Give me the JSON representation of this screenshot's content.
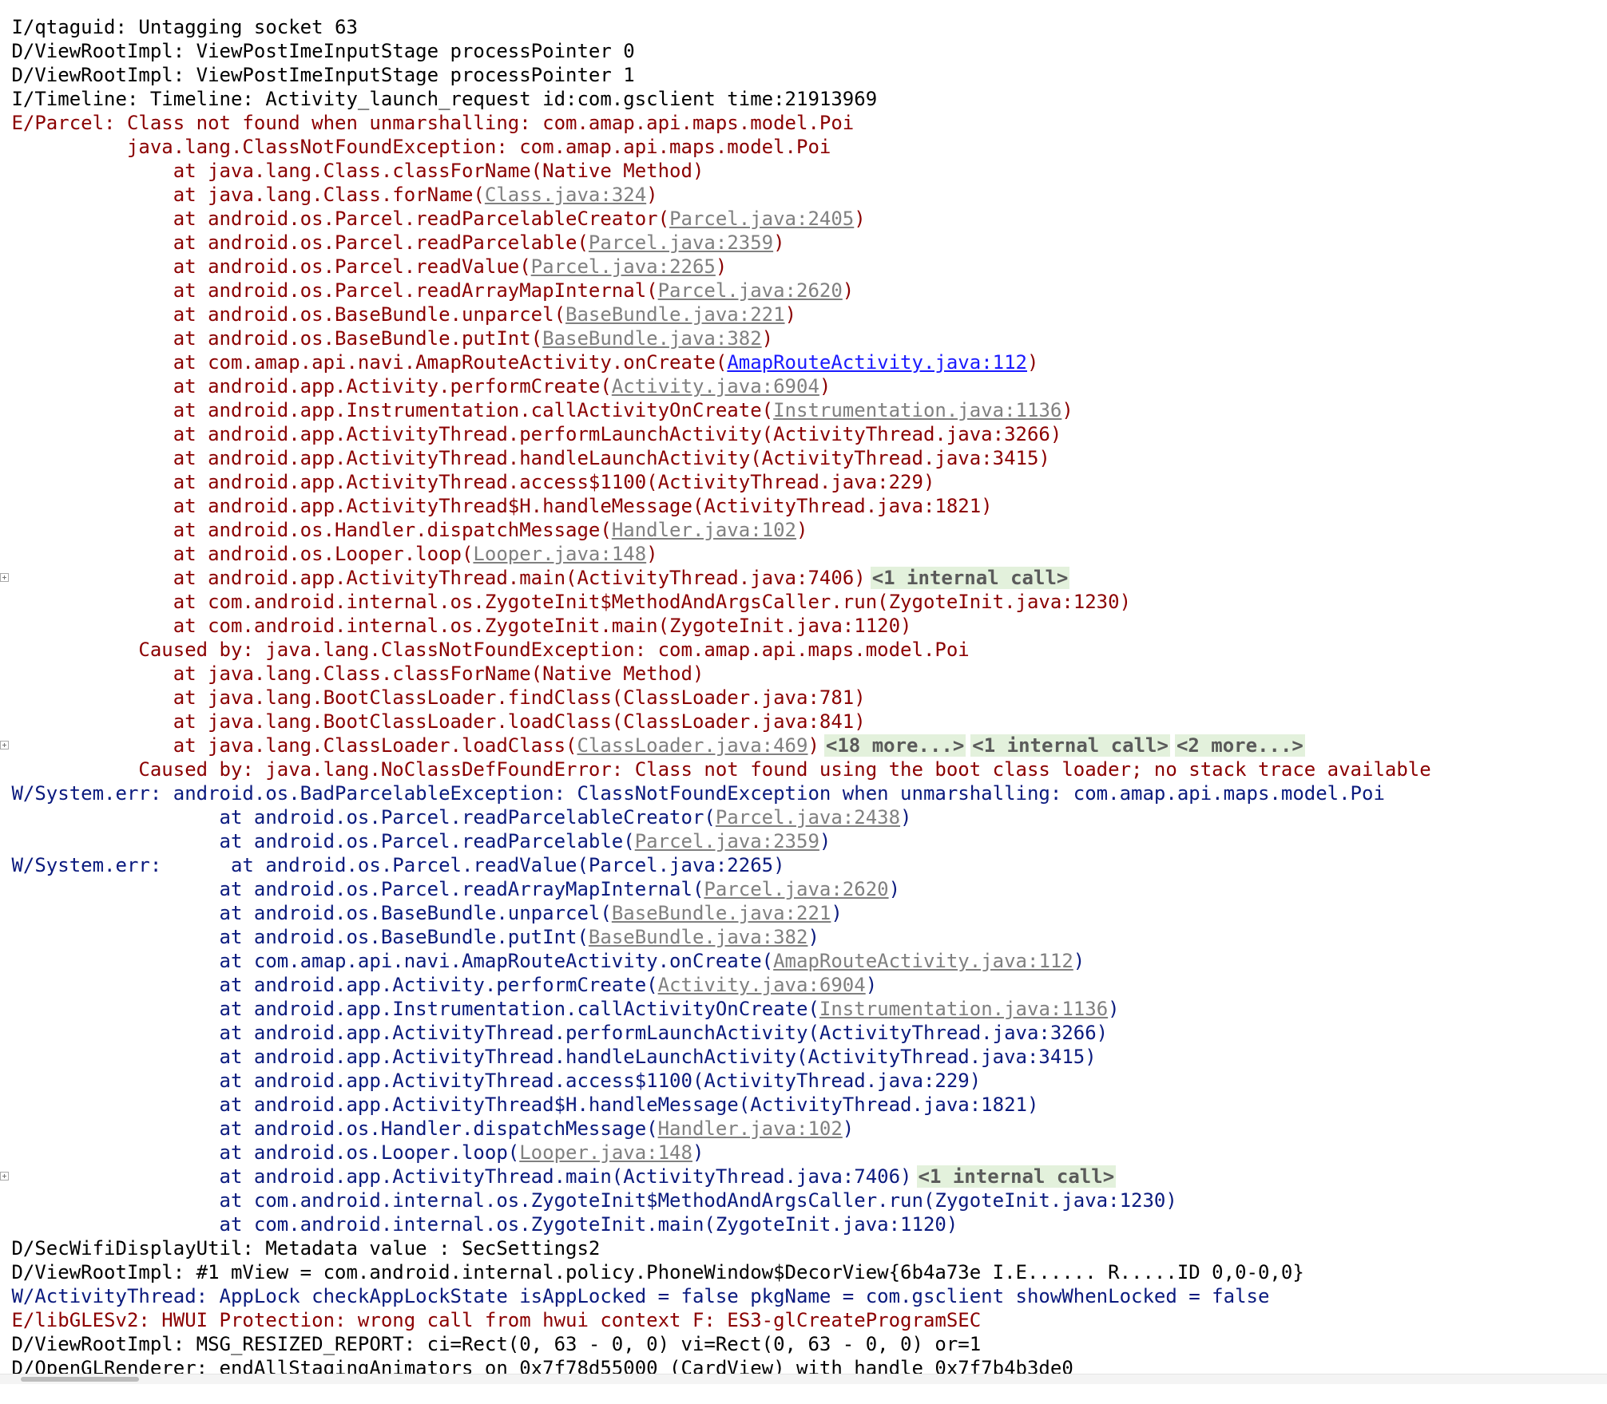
{
  "lines": [
    {
      "c": "log",
      "fold": false,
      "segs": [
        {
          "t": "                                                                                                                                      ",
          "k": "text"
        }
      ]
    },
    {
      "c": "log",
      "fold": false,
      "segs": [
        {
          "t": " I/qtaguid: Untagging socket 63",
          "k": "text"
        }
      ]
    },
    {
      "c": "log",
      "fold": false,
      "segs": [
        {
          "t": " D/ViewRootImpl: ViewPostImeInputStage processPointer 0",
          "k": "text"
        }
      ]
    },
    {
      "c": "log",
      "fold": false,
      "segs": [
        {
          "t": " D/ViewRootImpl: ViewPostImeInputStage processPointer 1",
          "k": "text"
        }
      ]
    },
    {
      "c": "log",
      "fold": false,
      "segs": [
        {
          "t": " I/Timeline: Timeline: Activity_launch_request id:com.gsclient time:21913969",
          "k": "text"
        }
      ]
    },
    {
      "c": "err",
      "fold": false,
      "segs": [
        {
          "t": " E/Parcel: Class not found when unmarshalling: com.amap.api.maps.model.Poi",
          "k": "text"
        }
      ]
    },
    {
      "c": "err",
      "fold": false,
      "segs": [
        {
          "t": "           java.lang.ClassNotFoundException: com.amap.api.maps.model.Poi",
          "k": "text"
        }
      ]
    },
    {
      "c": "err",
      "fold": false,
      "segs": [
        {
          "t": "               at java.lang.Class.classForName(Native Method)",
          "k": "text"
        }
      ]
    },
    {
      "c": "err",
      "fold": false,
      "segs": [
        {
          "t": "               at java.lang.Class.forName(",
          "k": "text"
        },
        {
          "t": "Class.java:324",
          "k": "link"
        },
        {
          "t": ")",
          "k": "text"
        }
      ]
    },
    {
      "c": "err",
      "fold": false,
      "segs": [
        {
          "t": "               at android.os.Parcel.readParcelableCreator(",
          "k": "text"
        },
        {
          "t": "Parcel.java:2405",
          "k": "link"
        },
        {
          "t": ")",
          "k": "text"
        }
      ]
    },
    {
      "c": "err",
      "fold": false,
      "segs": [
        {
          "t": "               at android.os.Parcel.readParcelable(",
          "k": "text"
        },
        {
          "t": "Parcel.java:2359",
          "k": "link"
        },
        {
          "t": ")",
          "k": "text"
        }
      ]
    },
    {
      "c": "err",
      "fold": false,
      "segs": [
        {
          "t": "               at android.os.Parcel.readValue(",
          "k": "text"
        },
        {
          "t": "Parcel.java:2265",
          "k": "link"
        },
        {
          "t": ")",
          "k": "text"
        }
      ]
    },
    {
      "c": "err",
      "fold": false,
      "segs": [
        {
          "t": "               at android.os.Parcel.readArrayMapInternal(",
          "k": "text"
        },
        {
          "t": "Parcel.java:2620",
          "k": "link"
        },
        {
          "t": ")",
          "k": "text"
        }
      ]
    },
    {
      "c": "err",
      "fold": false,
      "segs": [
        {
          "t": "               at android.os.BaseBundle.unparcel(",
          "k": "text"
        },
        {
          "t": "BaseBundle.java:221",
          "k": "link"
        },
        {
          "t": ")",
          "k": "text"
        }
      ]
    },
    {
      "c": "err",
      "fold": false,
      "segs": [
        {
          "t": "               at android.os.BaseBundle.putInt(",
          "k": "text"
        },
        {
          "t": "BaseBundle.java:382",
          "k": "link"
        },
        {
          "t": ")",
          "k": "text"
        }
      ]
    },
    {
      "c": "err",
      "fold": false,
      "segs": [
        {
          "t": "               at com.amap.api.navi.AmapRouteActivity.onCreate(",
          "k": "text"
        },
        {
          "t": "AmapRouteActivity.java:112",
          "k": "link-blue"
        },
        {
          "t": ")",
          "k": "text"
        }
      ]
    },
    {
      "c": "err",
      "fold": false,
      "segs": [
        {
          "t": "               at android.app.Activity.performCreate(",
          "k": "text"
        },
        {
          "t": "Activity.java:6904",
          "k": "link"
        },
        {
          "t": ")",
          "k": "text"
        }
      ]
    },
    {
      "c": "err",
      "fold": false,
      "segs": [
        {
          "t": "               at android.app.Instrumentation.callActivityOnCreate(",
          "k": "text"
        },
        {
          "t": "Instrumentation.java:1136",
          "k": "link"
        },
        {
          "t": ")",
          "k": "text"
        }
      ]
    },
    {
      "c": "err",
      "fold": false,
      "segs": [
        {
          "t": "               at android.app.ActivityThread.performLaunchActivity(ActivityThread.java:3266)",
          "k": "text"
        }
      ]
    },
    {
      "c": "err",
      "fold": false,
      "segs": [
        {
          "t": "               at android.app.ActivityThread.handleLaunchActivity(ActivityThread.java:3415)",
          "k": "text"
        }
      ]
    },
    {
      "c": "err",
      "fold": false,
      "segs": [
        {
          "t": "               at android.app.ActivityThread.access$1100(ActivityThread.java:229)",
          "k": "text"
        }
      ]
    },
    {
      "c": "err",
      "fold": false,
      "segs": [
        {
          "t": "               at android.app.ActivityThread$H.handleMessage(ActivityThread.java:1821)",
          "k": "text"
        }
      ]
    },
    {
      "c": "err",
      "fold": false,
      "segs": [
        {
          "t": "               at android.os.Handler.dispatchMessage(",
          "k": "text"
        },
        {
          "t": "Handler.java:102",
          "k": "link"
        },
        {
          "t": ")",
          "k": "text"
        }
      ]
    },
    {
      "c": "err",
      "fold": false,
      "segs": [
        {
          "t": "               at android.os.Looper.loop(",
          "k": "text"
        },
        {
          "t": "Looper.java:148",
          "k": "link"
        },
        {
          "t": ")",
          "k": "text"
        }
      ]
    },
    {
      "c": "err",
      "fold": true,
      "segs": [
        {
          "t": "               at android.app.ActivityThread.main(ActivityThread.java:7406)",
          "k": "text"
        },
        {
          "t": "<1 internal call>",
          "k": "fold"
        }
      ]
    },
    {
      "c": "err",
      "fold": false,
      "segs": [
        {
          "t": "               at com.android.internal.os.ZygoteInit$MethodAndArgsCaller.run(ZygoteInit.java:1230)",
          "k": "text"
        }
      ]
    },
    {
      "c": "err",
      "fold": false,
      "segs": [
        {
          "t": "               at com.android.internal.os.ZygoteInit.main(ZygoteInit.java:1120)",
          "k": "text"
        }
      ]
    },
    {
      "c": "err",
      "fold": false,
      "segs": [
        {
          "t": "            Caused by: java.lang.ClassNotFoundException: com.amap.api.maps.model.Poi",
          "k": "text"
        }
      ]
    },
    {
      "c": "err",
      "fold": false,
      "segs": [
        {
          "t": "               at java.lang.Class.classForName(Native Method)",
          "k": "text"
        }
      ]
    },
    {
      "c": "err",
      "fold": false,
      "segs": [
        {
          "t": "               at java.lang.BootClassLoader.findClass(ClassLoader.java:781)",
          "k": "text"
        }
      ]
    },
    {
      "c": "err",
      "fold": false,
      "segs": [
        {
          "t": "               at java.lang.BootClassLoader.loadClass(ClassLoader.java:841)",
          "k": "text"
        }
      ]
    },
    {
      "c": "err",
      "fold": true,
      "segs": [
        {
          "t": "               at java.lang.ClassLoader.loadClass(",
          "k": "text"
        },
        {
          "t": "ClassLoader.java:469",
          "k": "link"
        },
        {
          "t": ")",
          "k": "text"
        },
        {
          "t": "<18 more...>",
          "k": "fold"
        },
        {
          "t": "<1 internal call>",
          "k": "fold"
        },
        {
          "t": "<2 more...>",
          "k": "fold"
        }
      ]
    },
    {
      "c": "err",
      "fold": false,
      "segs": [
        {
          "t": "            Caused by: java.lang.NoClassDefFoundError: Class not found using the boot class loader; no stack trace available",
          "k": "text"
        }
      ]
    },
    {
      "c": "warn",
      "fold": false,
      "segs": [
        {
          "t": " W/System.err: android.os.BadParcelableException: ClassNotFoundException when unmarshalling: com.amap.api.maps.model.Poi",
          "k": "text"
        }
      ]
    },
    {
      "c": "warn",
      "fold": false,
      "segs": [
        {
          "t": "                   at android.os.Parcel.readParcelableCreator(",
          "k": "text"
        },
        {
          "t": "Parcel.java:2438",
          "k": "link"
        },
        {
          "t": ")",
          "k": "text"
        }
      ]
    },
    {
      "c": "warn",
      "fold": false,
      "segs": [
        {
          "t": "                   at android.os.Parcel.readParcelable(",
          "k": "text"
        },
        {
          "t": "Parcel.java:2359",
          "k": "link"
        },
        {
          "t": ")",
          "k": "text"
        }
      ]
    },
    {
      "c": "warn",
      "fold": false,
      "segs": [
        {
          "t": " W/System.err:      at android.os.Parcel.readValue(Parcel.java:2265)",
          "k": "text"
        }
      ]
    },
    {
      "c": "warn",
      "fold": false,
      "segs": [
        {
          "t": "                   at android.os.Parcel.readArrayMapInternal(",
          "k": "text"
        },
        {
          "t": "Parcel.java:2620",
          "k": "link"
        },
        {
          "t": ")",
          "k": "text"
        }
      ]
    },
    {
      "c": "warn",
      "fold": false,
      "segs": [
        {
          "t": "                   at android.os.BaseBundle.unparcel(",
          "k": "text"
        },
        {
          "t": "BaseBundle.java:221",
          "k": "link"
        },
        {
          "t": ")",
          "k": "text"
        }
      ]
    },
    {
      "c": "warn",
      "fold": false,
      "segs": [
        {
          "t": "                   at android.os.BaseBundle.putInt(",
          "k": "text"
        },
        {
          "t": "BaseBundle.java:382",
          "k": "link"
        },
        {
          "t": ")",
          "k": "text"
        }
      ]
    },
    {
      "c": "warn",
      "fold": false,
      "segs": [
        {
          "t": "                   at com.amap.api.navi.AmapRouteActivity.onCreate(",
          "k": "text"
        },
        {
          "t": "AmapRouteActivity.java:112",
          "k": "link"
        },
        {
          "t": ")",
          "k": "text"
        }
      ]
    },
    {
      "c": "warn",
      "fold": false,
      "segs": [
        {
          "t": "                   at android.app.Activity.performCreate(",
          "k": "text"
        },
        {
          "t": "Activity.java:6904",
          "k": "link"
        },
        {
          "t": ")",
          "k": "text"
        }
      ]
    },
    {
      "c": "warn",
      "fold": false,
      "segs": [
        {
          "t": "                   at android.app.Instrumentation.callActivityOnCreate(",
          "k": "text"
        },
        {
          "t": "Instrumentation.java:1136",
          "k": "link"
        },
        {
          "t": ")",
          "k": "text"
        }
      ]
    },
    {
      "c": "warn",
      "fold": false,
      "segs": [
        {
          "t": "                   at android.app.ActivityThread.performLaunchActivity(ActivityThread.java:3266)",
          "k": "text"
        }
      ]
    },
    {
      "c": "warn",
      "fold": false,
      "segs": [
        {
          "t": "                   at android.app.ActivityThread.handleLaunchActivity(ActivityThread.java:3415)",
          "k": "text"
        }
      ]
    },
    {
      "c": "warn",
      "fold": false,
      "segs": [
        {
          "t": "                   at android.app.ActivityThread.access$1100(ActivityThread.java:229)",
          "k": "text"
        }
      ]
    },
    {
      "c": "warn",
      "fold": false,
      "segs": [
        {
          "t": "                   at android.app.ActivityThread$H.handleMessage(ActivityThread.java:1821)",
          "k": "text"
        }
      ]
    },
    {
      "c": "warn",
      "fold": false,
      "segs": [
        {
          "t": "                   at android.os.Handler.dispatchMessage(",
          "k": "text"
        },
        {
          "t": "Handler.java:102",
          "k": "link"
        },
        {
          "t": ")",
          "k": "text"
        }
      ]
    },
    {
      "c": "warn",
      "fold": false,
      "segs": [
        {
          "t": "                   at android.os.Looper.loop(",
          "k": "text"
        },
        {
          "t": "Looper.java:148",
          "k": "link"
        },
        {
          "t": ")",
          "k": "text"
        }
      ]
    },
    {
      "c": "warn",
      "fold": true,
      "segs": [
        {
          "t": "                   at android.app.ActivityThread.main(ActivityThread.java:7406)",
          "k": "text"
        },
        {
          "t": "<1 internal call>",
          "k": "fold"
        }
      ]
    },
    {
      "c": "warn",
      "fold": false,
      "segs": [
        {
          "t": "                   at com.android.internal.os.ZygoteInit$MethodAndArgsCaller.run(ZygoteInit.java:1230)",
          "k": "text"
        }
      ]
    },
    {
      "c": "warn",
      "fold": false,
      "segs": [
        {
          "t": "                   at com.android.internal.os.ZygoteInit.main(ZygoteInit.java:1120)",
          "k": "text"
        }
      ]
    },
    {
      "c": "log",
      "fold": false,
      "segs": [
        {
          "t": " D/SecWifiDisplayUtil: Metadata value : SecSettings2",
          "k": "text"
        }
      ]
    },
    {
      "c": "log",
      "fold": false,
      "segs": [
        {
          "t": " D/ViewRootImpl: #1 mView = com.android.internal.policy.PhoneWindow$DecorView{6b4a73e I.E...... R.....ID 0,0-0,0}",
          "k": "text"
        }
      ]
    },
    {
      "c": "warn",
      "fold": false,
      "segs": [
        {
          "t": " W/ActivityThread: AppLock checkAppLockState isAppLocked = false pkgName = com.gsclient showWhenLocked = false",
          "k": "text"
        }
      ]
    },
    {
      "c": "err",
      "fold": false,
      "segs": [
        {
          "t": " E/libGLESv2: HWUI Protection: wrong call from hwui context F: ES3-glCreateProgramSEC",
          "k": "text"
        }
      ]
    },
    {
      "c": "log",
      "fold": false,
      "segs": [
        {
          "t": " D/ViewRootImpl: MSG_RESIZED_REPORT: ci=Rect(0, 63 - 0, 0) vi=Rect(0, 63 - 0, 0) or=1",
          "k": "text"
        }
      ]
    },
    {
      "c": "log",
      "fold": false,
      "segs": [
        {
          "t": " D/OpenGLRenderer: endAllStagingAnimators on 0x7f78d55000 (CardView) with handle 0x7f7b4b3de0",
          "k": "text"
        }
      ]
    },
    {
      "c": "log",
      "fold": false,
      "segs": [
        {
          "t": "",
          "k": "text"
        }
      ]
    }
  ],
  "icons": {
    "fold_toggle": "expand-plus-icon"
  },
  "colors": {
    "log": "#000000",
    "error": "#8b0000",
    "warning": "#0a1a7e",
    "link": "#808080",
    "link_active": "#1a1aff",
    "fold_bg": "#e3f1dc"
  }
}
